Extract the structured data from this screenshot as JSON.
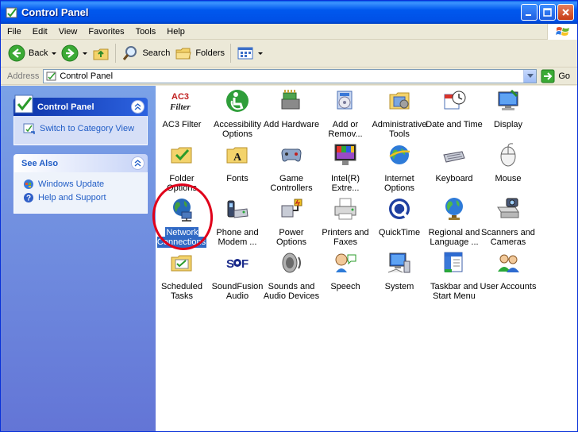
{
  "window": {
    "title": "Control Panel"
  },
  "menu": [
    "File",
    "Edit",
    "View",
    "Favorites",
    "Tools",
    "Help"
  ],
  "toolbar": {
    "back": "Back",
    "search": "Search",
    "folders": "Folders"
  },
  "address": {
    "label": "Address",
    "value": "Control Panel",
    "go": "Go"
  },
  "taskpane": {
    "control_panel": {
      "title": "Control Panel",
      "link": "Switch to Category View"
    },
    "see_also": {
      "title": "See Also",
      "links": [
        "Windows Update",
        "Help and Support"
      ]
    }
  },
  "items": [
    {
      "label": "AC3 Filter",
      "icon": "ac3-filter-icon"
    },
    {
      "label": "Accessibility Options",
      "icon": "accessibility-icon"
    },
    {
      "label": "Add Hardware",
      "icon": "add-hardware-icon"
    },
    {
      "label": "Add or Remov...",
      "icon": "add-remove-programs-icon"
    },
    {
      "label": "Administrative Tools",
      "icon": "administrative-tools-icon"
    },
    {
      "label": "Date and Time",
      "icon": "date-time-icon"
    },
    {
      "label": "Display",
      "icon": "display-icon"
    },
    {
      "label": "Folder Options",
      "icon": "folder-options-icon"
    },
    {
      "label": "Fonts",
      "icon": "fonts-icon"
    },
    {
      "label": "Game Controllers",
      "icon": "game-controllers-icon"
    },
    {
      "label": "Intel(R) Extre...",
      "icon": "intel-graphics-icon"
    },
    {
      "label": "Internet Options",
      "icon": "internet-options-icon"
    },
    {
      "label": "Keyboard",
      "icon": "keyboard-icon"
    },
    {
      "label": "Mouse",
      "icon": "mouse-icon"
    },
    {
      "label": "Network Connections",
      "icon": "network-connections-icon",
      "selected": true
    },
    {
      "label": "Phone and Modem ...",
      "icon": "phone-modem-icon"
    },
    {
      "label": "Power Options",
      "icon": "power-options-icon"
    },
    {
      "label": "Printers and Faxes",
      "icon": "printers-faxes-icon"
    },
    {
      "label": "QuickTime",
      "icon": "quicktime-icon"
    },
    {
      "label": "Regional and Language ...",
      "icon": "regional-language-icon"
    },
    {
      "label": "Scanners and Cameras",
      "icon": "scanners-cameras-icon"
    },
    {
      "label": "Scheduled Tasks",
      "icon": "scheduled-tasks-icon"
    },
    {
      "label": "SoundFusion Audio",
      "icon": "soundfusion-audio-icon"
    },
    {
      "label": "Sounds and Audio Devices",
      "icon": "sounds-audio-icon"
    },
    {
      "label": "Speech",
      "icon": "speech-icon"
    },
    {
      "label": "System",
      "icon": "system-icon"
    },
    {
      "label": "Taskbar and Start Menu",
      "icon": "taskbar-start-menu-icon"
    },
    {
      "label": "User Accounts",
      "icon": "user-accounts-icon"
    }
  ],
  "colors": {
    "titlebar": "#0058EE",
    "selection": "#316AC5",
    "annotation": "#E0001A",
    "taskpane": "#7BA2E7"
  }
}
